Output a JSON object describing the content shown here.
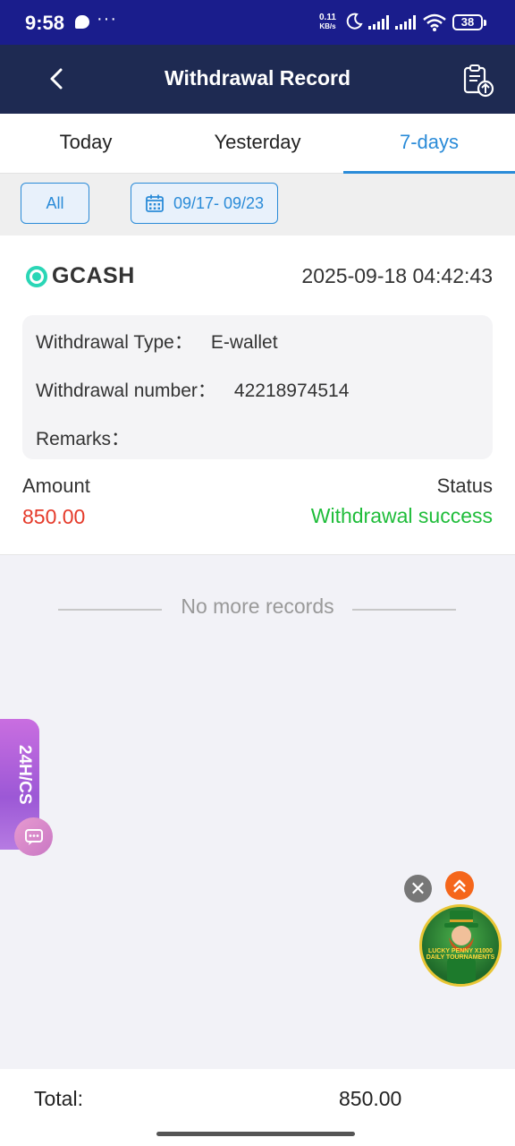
{
  "status_bar": {
    "time": "9:58",
    "menu_dots": "···",
    "net_speed_value": "0.11",
    "net_speed_unit": "KB/s",
    "battery": "38"
  },
  "header": {
    "title": "Withdrawal Record",
    "back_icon": "chevron-left-icon",
    "record_icon": "clipboard-upload-icon"
  },
  "tabs": [
    {
      "label": "Today",
      "active": false
    },
    {
      "label": "Yesterday",
      "active": false
    },
    {
      "label": "7-days",
      "active": true
    }
  ],
  "filters": {
    "all_label": "All",
    "date_range": "09/17- 09/23"
  },
  "record": {
    "method": "GCASH",
    "datetime": "2025-09-18 04:42:43",
    "type_label": "Withdrawal Type：",
    "type_value": "E-wallet",
    "number_label": "Withdrawal number：",
    "number_value": "42218974514",
    "remarks_label": "Remarks：",
    "remarks_value": "",
    "amount_label": "Amount",
    "amount_value": "850.00",
    "status_label": "Status",
    "status_value": "Withdrawal success"
  },
  "list_end": "No more records",
  "cs_tab": {
    "label": "24H/CS"
  },
  "promo": {
    "close": "✕",
    "text_line1": "LUCKY PENNY X1000",
    "text_line2": "DAILY TOURNAMENTS"
  },
  "footer": {
    "total_label": "Total:",
    "total_value": "850.00"
  },
  "colors": {
    "status_bar": "#1a1d8c",
    "header": "#1e2a52",
    "accent": "#2a8bd8",
    "amount": "#e53a2a",
    "success": "#1fbd3a"
  }
}
